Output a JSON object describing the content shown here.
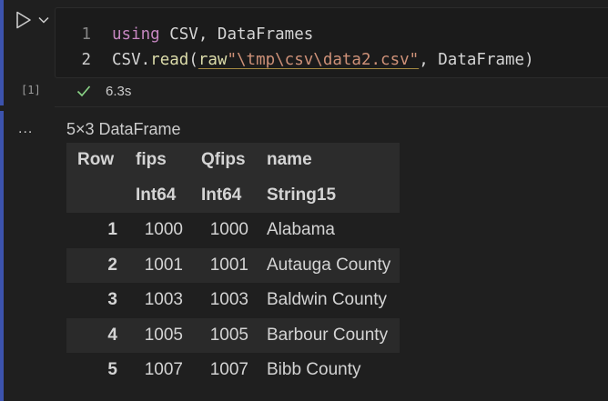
{
  "cell": {
    "execution_count": "[1]",
    "run_icon": "play-icon",
    "run_menu_icon": "chevron-down-icon",
    "code": [
      {
        "line_number": "1",
        "tokens": [
          {
            "type": "kw",
            "text": "using"
          },
          {
            "type": "pl",
            "text": " CSV, DataFrames"
          }
        ]
      },
      {
        "line_number": "2",
        "tokens": [
          {
            "type": "pl",
            "text": "CSV."
          },
          {
            "type": "fn",
            "text": "read"
          },
          {
            "type": "pl",
            "text": "("
          },
          {
            "type": "fn",
            "text": "raw"
          },
          {
            "type": "str",
            "text": "\"\\tmp\\csv\\data2.csv\""
          },
          {
            "type": "pl",
            "text": ", DataFrame)"
          }
        ]
      }
    ],
    "status": {
      "icon": "check-icon",
      "time": "6.3s",
      "color": "#89d185"
    }
  },
  "output": {
    "menu_label": "...",
    "summary": "5×3 DataFrame",
    "table": {
      "headers": [
        "Row",
        "fips",
        "Qfips",
        "name"
      ],
      "types": [
        "",
        "Int64",
        "Int64",
        "String15"
      ],
      "rows": [
        [
          "1",
          "1000",
          "1000",
          "Alabama"
        ],
        [
          "2",
          "1001",
          "1001",
          "Autauga County"
        ],
        [
          "3",
          "1003",
          "1003",
          "Baldwin County"
        ],
        [
          "4",
          "1005",
          "1005",
          "Barbour County"
        ],
        [
          "5",
          "1007",
          "1007",
          "Bibb County"
        ]
      ]
    }
  },
  "colors": {
    "cell_accent": "#3c53ad",
    "keyword": "#c586c0",
    "function": "#dcdcaa",
    "string": "#ce9178",
    "success": "#89d185"
  }
}
